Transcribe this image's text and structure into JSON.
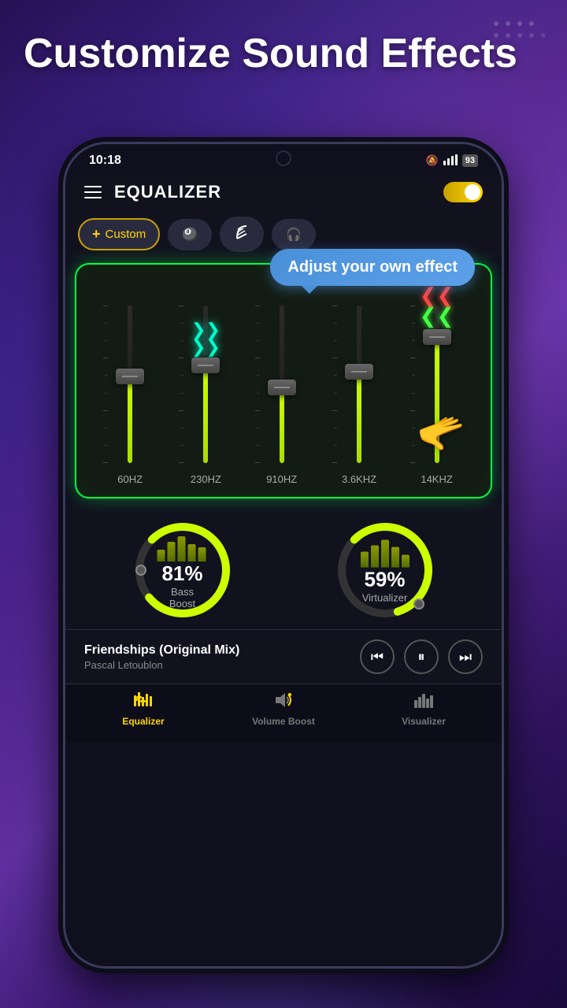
{
  "page": {
    "background_title": "Customize Sound Effects",
    "status_bar": {
      "time": "10:18",
      "battery_percent": "93"
    },
    "app_header": {
      "title": "EQUALIZER"
    },
    "preset_tabs": [
      {
        "id": "custom",
        "label": "Custom",
        "active": true,
        "icon": "plus"
      },
      {
        "id": "bass",
        "label": "",
        "active": false,
        "icon": "8ball"
      },
      {
        "id": "harp",
        "label": "",
        "active": false,
        "icon": "harp"
      },
      {
        "id": "headphone",
        "label": "",
        "active": false,
        "icon": "headphone"
      }
    ],
    "eq_bands": [
      {
        "id": "60hz",
        "label": "60HZ",
        "fill_percent": 55
      },
      {
        "id": "230hz",
        "label": "230HZ",
        "fill_percent": 62
      },
      {
        "id": "910hz",
        "label": "910HZ",
        "fill_percent": 48
      },
      {
        "id": "3k6hz",
        "label": "3.6KHZ",
        "fill_percent": 58
      },
      {
        "id": "14khz",
        "label": "14KHZ",
        "fill_percent": 80
      }
    ],
    "tooltip": "Adjust your own effect",
    "bass_boost": {
      "value": 81,
      "label": "Bass Boost",
      "unit": "%"
    },
    "virtualizer": {
      "value": 59,
      "label": "Virtualizer",
      "unit": "%"
    },
    "now_playing": {
      "title": "Friendships (Original Mix)",
      "artist": "Pascal Letoublon"
    },
    "player_controls": {
      "prev": "⏮",
      "pause": "⏸",
      "next": "⏭"
    },
    "bottom_nav": [
      {
        "id": "equalizer",
        "label": "Equalizer",
        "icon": "eq",
        "active": true
      },
      {
        "id": "volume-boost",
        "label": "Volume Boost",
        "icon": "volume",
        "active": false
      },
      {
        "id": "visualizer",
        "label": "Visualizer",
        "icon": "bars",
        "active": false
      }
    ]
  }
}
